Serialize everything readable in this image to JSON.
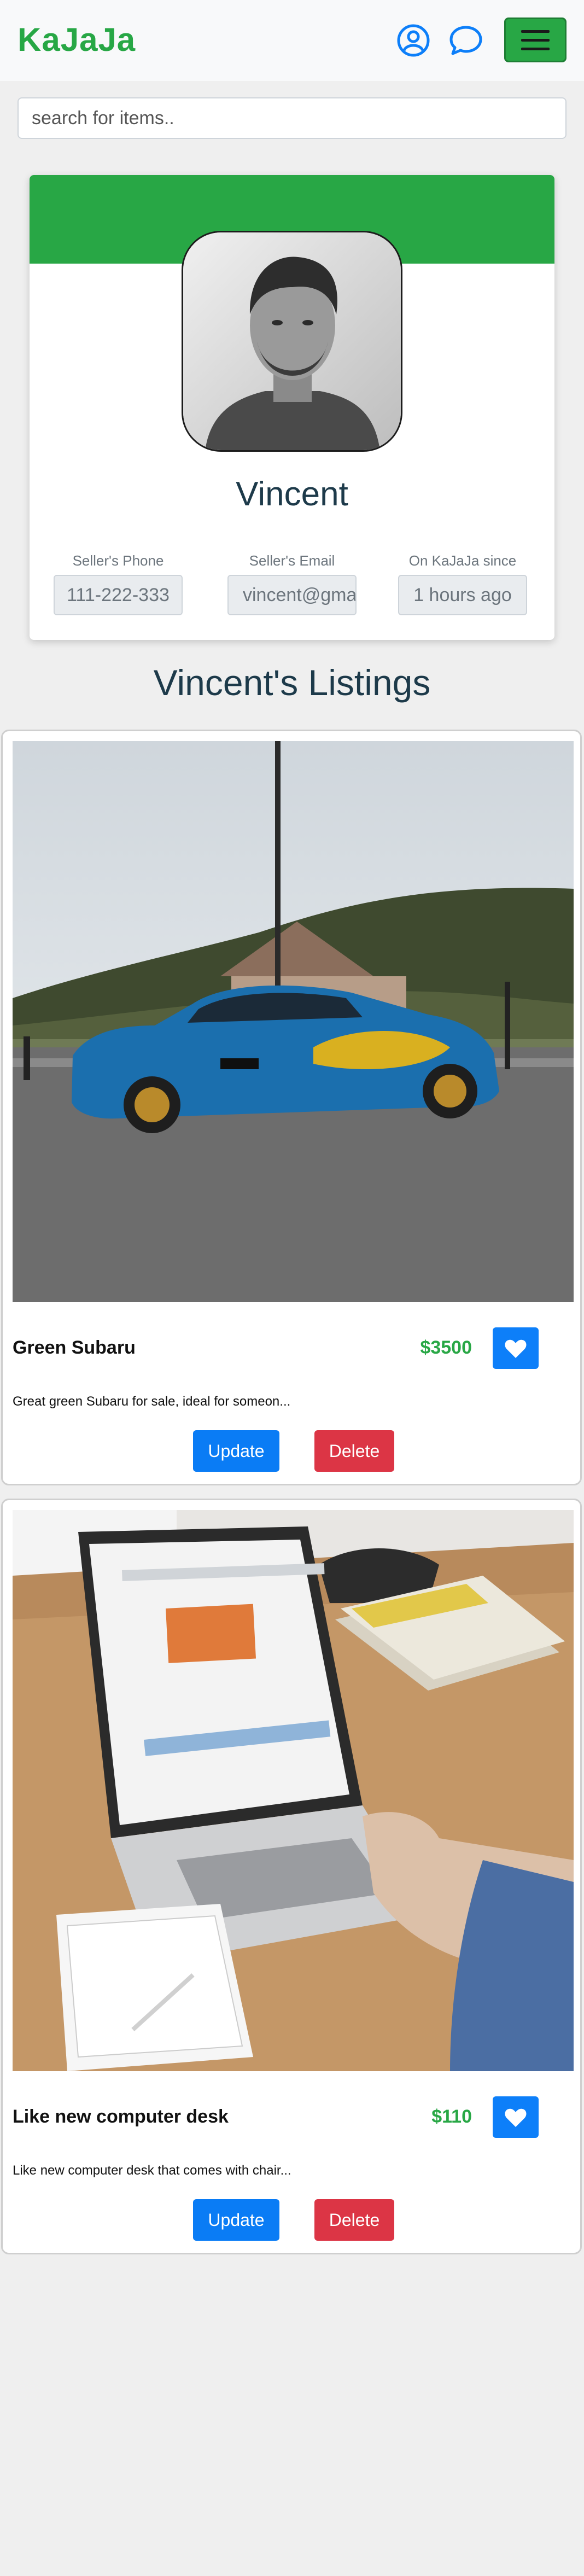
{
  "navbar": {
    "brand": "KaJaJa",
    "icons": [
      "user-circle-icon",
      "chat-bubble-icon",
      "hamburger-menu-icon"
    ]
  },
  "search": {
    "placeholder": "search for items.."
  },
  "profile": {
    "name": "Vincent",
    "phone_label": "Seller's Phone",
    "phone_value": "111-222-333",
    "email_label": "Seller's Email",
    "email_value": "vincent@gmail.com",
    "since_label": "On KaJaJa since",
    "since_value": "1 hours ago"
  },
  "listings_title": "Vincent's Listings",
  "listings": [
    {
      "name": "Green Subaru",
      "price": "$3500",
      "description": "Great green Subaru for sale, ideal for someon...",
      "update_label": "Update",
      "delete_label": "Delete"
    },
    {
      "name": "Like new computer desk",
      "price": "$110",
      "description": "Like new computer desk that comes with chair...",
      "update_label": "Update",
      "delete_label": "Delete"
    }
  ],
  "colors": {
    "brand_green": "#28a745",
    "primary_blue": "#0d7ff9",
    "danger_red": "#dc3545",
    "heading_dark": "#1d3a4a"
  }
}
